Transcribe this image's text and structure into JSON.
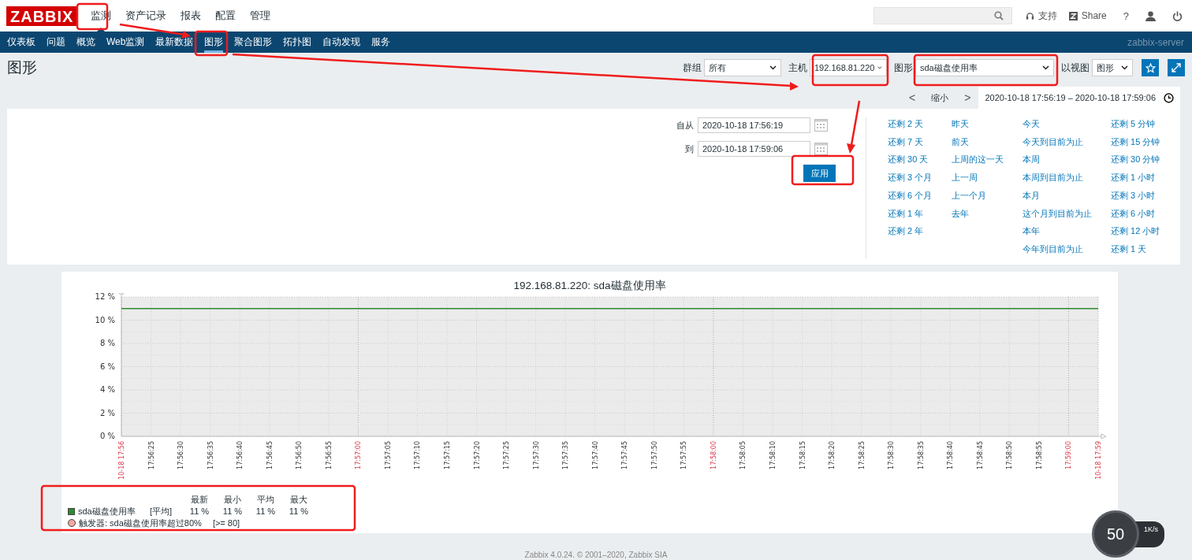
{
  "logo": "ZABBIX",
  "top_menu": [
    {
      "label": "监测",
      "selected": true
    },
    {
      "label": "资产记录",
      "selected": false
    },
    {
      "label": "报表",
      "selected": false
    },
    {
      "label": "配置",
      "selected": false
    },
    {
      "label": "管理",
      "selected": false
    }
  ],
  "header_links": {
    "support": "支持",
    "share": "Share",
    "help": "?"
  },
  "sub_menu": [
    {
      "label": "仪表板",
      "selected": false
    },
    {
      "label": "问题",
      "selected": false
    },
    {
      "label": "概览",
      "selected": false
    },
    {
      "label": "Web监测",
      "selected": false
    },
    {
      "label": "最新数据",
      "selected": false
    },
    {
      "label": "图形",
      "selected": true
    },
    {
      "label": "聚合图形",
      "selected": false
    },
    {
      "label": "拓扑图",
      "selected": false
    },
    {
      "label": "自动发现",
      "selected": false
    },
    {
      "label": "服务",
      "selected": false
    }
  ],
  "server_name": "zabbix-server",
  "page_title": "图形",
  "filters": [
    {
      "label": "群组",
      "value": "所有"
    },
    {
      "label": "主机",
      "value": "192.168.81.220"
    },
    {
      "label": "图形",
      "value": "sda磁盘使用率"
    },
    {
      "label": "以视图",
      "value": "图形"
    }
  ],
  "time_nav": {
    "prev": "<",
    "zoom_out": "缩小",
    "next": ">",
    "range": "2020-10-18 17:56:19 – 2020-10-18 17:59:06"
  },
  "time_form": {
    "from_label": "自从",
    "from": "2020-10-18 17:56:19",
    "to_label": "到",
    "to": "2020-10-18 17:59:06",
    "apply": "应用"
  },
  "quick_ranges": [
    [
      "还剩 2 天",
      "还剩 7 天",
      "还剩 30 天",
      "还剩 3 个月",
      "还剩 6 个月",
      "还剩 1 年",
      "还剩 2 年"
    ],
    [
      "昨天",
      "前天",
      "上周的这一天",
      "上一周",
      "上一个月",
      "去年"
    ],
    [
      "今天",
      "今天到目前为止",
      "本周",
      "本周到目前为止",
      "本月",
      "这个月到目前为止",
      "本年",
      "今年到目前为止"
    ],
    [
      "还剩 5 分钟",
      "还剩 15 分钟",
      "还剩 30 分钟",
      "还剩 1 小时",
      "还剩 3 小时",
      "还剩 6 小时",
      "还剩 12 小时",
      "还剩 1 天"
    ]
  ],
  "graph": {
    "title": "192.168.81.220: sda磁盘使用率",
    "chart_data": {
      "type": "line",
      "grid": true,
      "ylim": [
        0,
        12
      ],
      "yticks": [
        {
          "value": 0,
          "label": "0 %"
        },
        {
          "value": 2,
          "label": "2 %"
        },
        {
          "value": 4,
          "label": "4 %"
        },
        {
          "value": 6,
          "label": "6 %"
        },
        {
          "value": 8,
          "label": "8 %"
        },
        {
          "value": 10,
          "label": "10 %"
        },
        {
          "value": 12,
          "label": "12 %"
        }
      ],
      "categories": [
        "10-18 17:56",
        "17:56:25",
        "17:56:30",
        "17:56:35",
        "17:56:40",
        "17:56:45",
        "17:56:50",
        "17:56:55",
        "17:57:00",
        "17:57:05",
        "17:57:10",
        "17:57:15",
        "17:57:20",
        "17:57:25",
        "17:57:30",
        "17:57:35",
        "17:57:40",
        "17:57:45",
        "17:57:50",
        "17:57:55",
        "17:58:00",
        "17:58:05",
        "17:58:10",
        "17:58:15",
        "17:58:20",
        "17:58:25",
        "17:58:30",
        "17:58:35",
        "17:58:40",
        "17:58:45",
        "17:58:50",
        "17:58:55",
        "17:59:00",
        "10-18 17:59"
      ],
      "series": [
        {
          "name": "sda磁盘使用率",
          "color": "#2e8b2e",
          "values": [
            11,
            11,
            11,
            11,
            11,
            11,
            11,
            11,
            11,
            11,
            11,
            11,
            11,
            11,
            11,
            11,
            11,
            11,
            11,
            11,
            11,
            11,
            11,
            11,
            11,
            11,
            11,
            11,
            11,
            11,
            11,
            11,
            11,
            11
          ]
        }
      ]
    },
    "legend": {
      "headers": [
        "最新",
        "最小",
        "平均",
        "最大"
      ],
      "items": [
        {
          "func": "[平均]",
          "values": [
            "11 %",
            "11 %",
            "11 %",
            "11 %"
          ]
        }
      ],
      "trigger": {
        "text": "触发器: sda磁盘使用率超过80%",
        "condition": "[>= 80]",
        "color": "#f4a8a0"
      }
    }
  },
  "speed_widget": {
    "value": "50",
    "rate": "1K/s"
  },
  "footer": "Zabbix 4.0.24. © 2001–2020, Zabbix SIA"
}
